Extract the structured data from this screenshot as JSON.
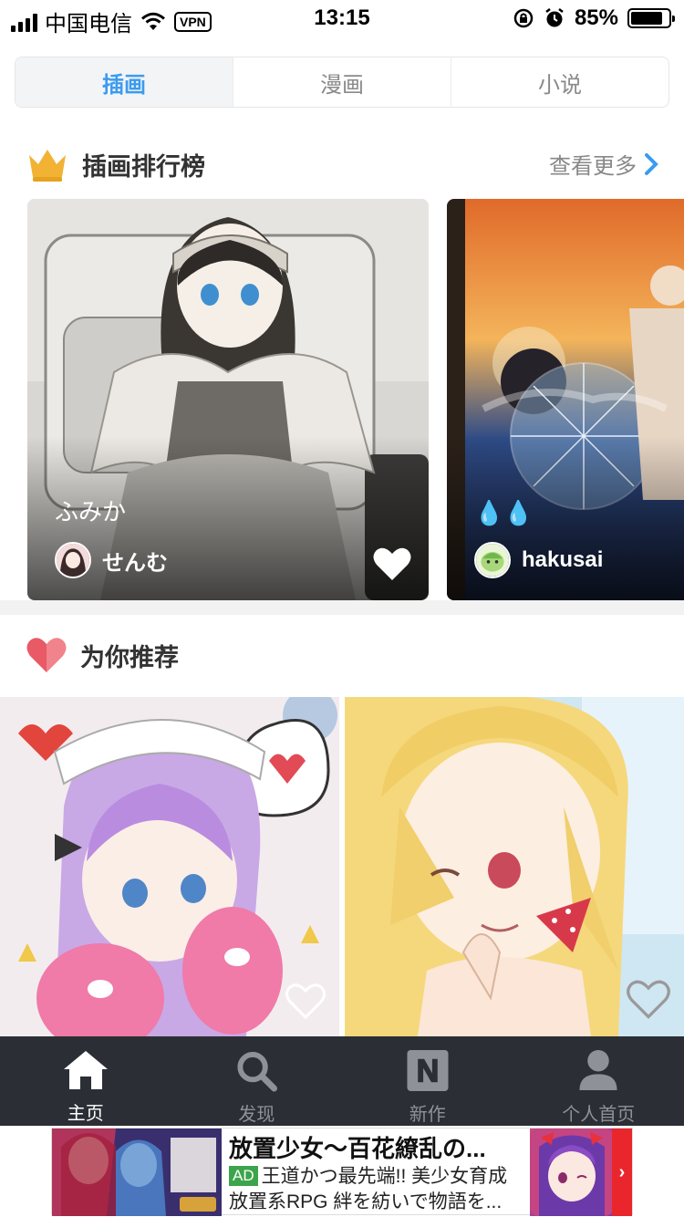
{
  "status_bar": {
    "carrier": "中国电信",
    "vpn": "VPN",
    "time": "13:15",
    "battery": "85%",
    "battery_level": 0.85
  },
  "top_tabs": [
    {
      "label": "插画",
      "active": true
    },
    {
      "label": "漫画",
      "active": false
    },
    {
      "label": "小说",
      "active": false
    }
  ],
  "ranking": {
    "title": "插画排行榜",
    "more_label": "查看更多",
    "cards": [
      {
        "title": "ふみか",
        "author": "せんむ",
        "liked": false
      },
      {
        "title": "💧💧",
        "author": "hakusai",
        "liked": false
      }
    ]
  },
  "recommend": {
    "title": "为你推荐"
  },
  "tabbar": [
    {
      "label": "主页",
      "icon": "home-icon",
      "active": true
    },
    {
      "label": "发现",
      "icon": "search-icon",
      "active": false
    },
    {
      "label": "新作",
      "icon": "new-n-icon",
      "active": false
    },
    {
      "label": "个人首页",
      "icon": "person-icon",
      "active": false
    }
  ],
  "ad": {
    "title": "放置少女～百花繚乱の...",
    "badge": "AD",
    "line1": "王道かつ最先端!! 美少女育成",
    "line2": "放置系RPG 絆を紡いで物語を...",
    "arrow": "›"
  },
  "colors": {
    "accent": "#3b9bf0",
    "tabbar_bg": "#2b2f35",
    "crown": "#f2b233",
    "heart": "#e85a66",
    "ad_arrow": "#e8262c"
  }
}
